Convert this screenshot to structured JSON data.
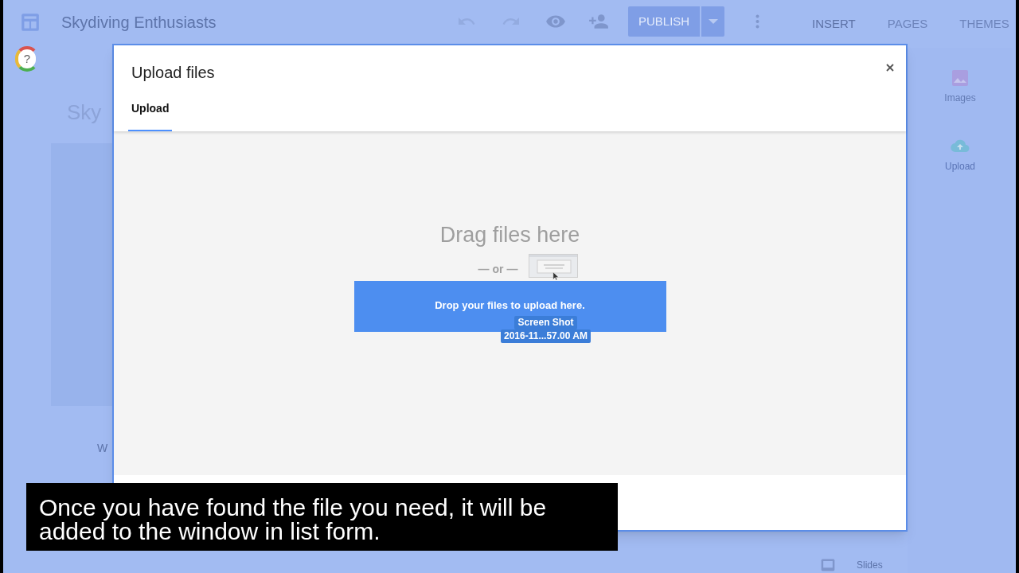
{
  "app": {
    "title": "Skydiving Enthusiasts",
    "publish": "PUBLISH",
    "tabs": [
      {
        "label": "INSERT",
        "selected": true
      },
      {
        "label": "PAGES",
        "selected": false
      },
      {
        "label": "THEMES",
        "selected": false
      }
    ],
    "help": "?",
    "page_title": "Sky",
    "page_text": "W",
    "insert_items": [
      {
        "kind": "images",
        "label": "Images"
      },
      {
        "kind": "upload",
        "label": "Upload"
      }
    ],
    "bottom_item": "Slides"
  },
  "dialog": {
    "title": "Upload files",
    "tabs": [
      {
        "label": "Upload",
        "selected": true
      }
    ],
    "drop_title": "Drag files here",
    "or": "— or —",
    "drop_button": "Drop your files to upload here.",
    "drag_label": [
      "Screen Shot",
      "2016-11...57.00 AM"
    ]
  },
  "caption": "Once you have found the file you need, it will be added to the window in list form."
}
